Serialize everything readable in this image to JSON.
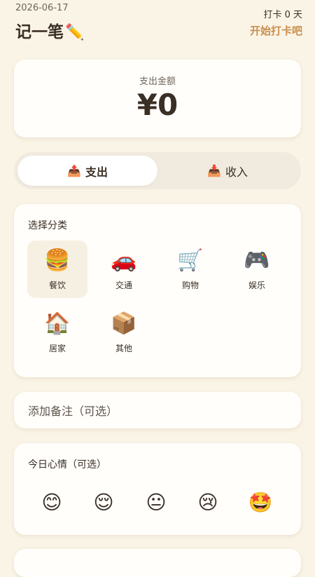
{
  "header": {
    "date": "2026-06-17",
    "app_title": "记一笔",
    "title_emoji": "✏️",
    "streak": "打卡 0 天",
    "checkin_link": "开始打卡吧"
  },
  "amount": {
    "label": "支出金额",
    "value": "¥0"
  },
  "type_toggle": {
    "expense_icon": "📤",
    "expense_label": "支出",
    "income_icon": "📥",
    "income_label": "收入",
    "active": "expense"
  },
  "categories": {
    "title": "选择分类",
    "items": [
      {
        "icon": "🍔",
        "label": "餐饮",
        "selected": true
      },
      {
        "icon": "🚗",
        "label": "交通",
        "selected": false
      },
      {
        "icon": "🛒",
        "label": "购物",
        "selected": false
      },
      {
        "icon": "🎮",
        "label": "娱乐",
        "selected": false
      },
      {
        "icon": "🏠",
        "label": "居家",
        "selected": false
      },
      {
        "icon": "📦",
        "label": "其他",
        "selected": false
      }
    ]
  },
  "note": {
    "placeholder": "添加备注（可选）",
    "value": ""
  },
  "mood": {
    "title": "今日心情（可选）",
    "options": [
      "😊",
      "😌",
      "😐",
      "😢",
      "🤩"
    ]
  },
  "colors": {
    "background": "#faf4e6",
    "accent": "#c98f4e",
    "text": "#3a2f25",
    "card": "#fffefb"
  }
}
